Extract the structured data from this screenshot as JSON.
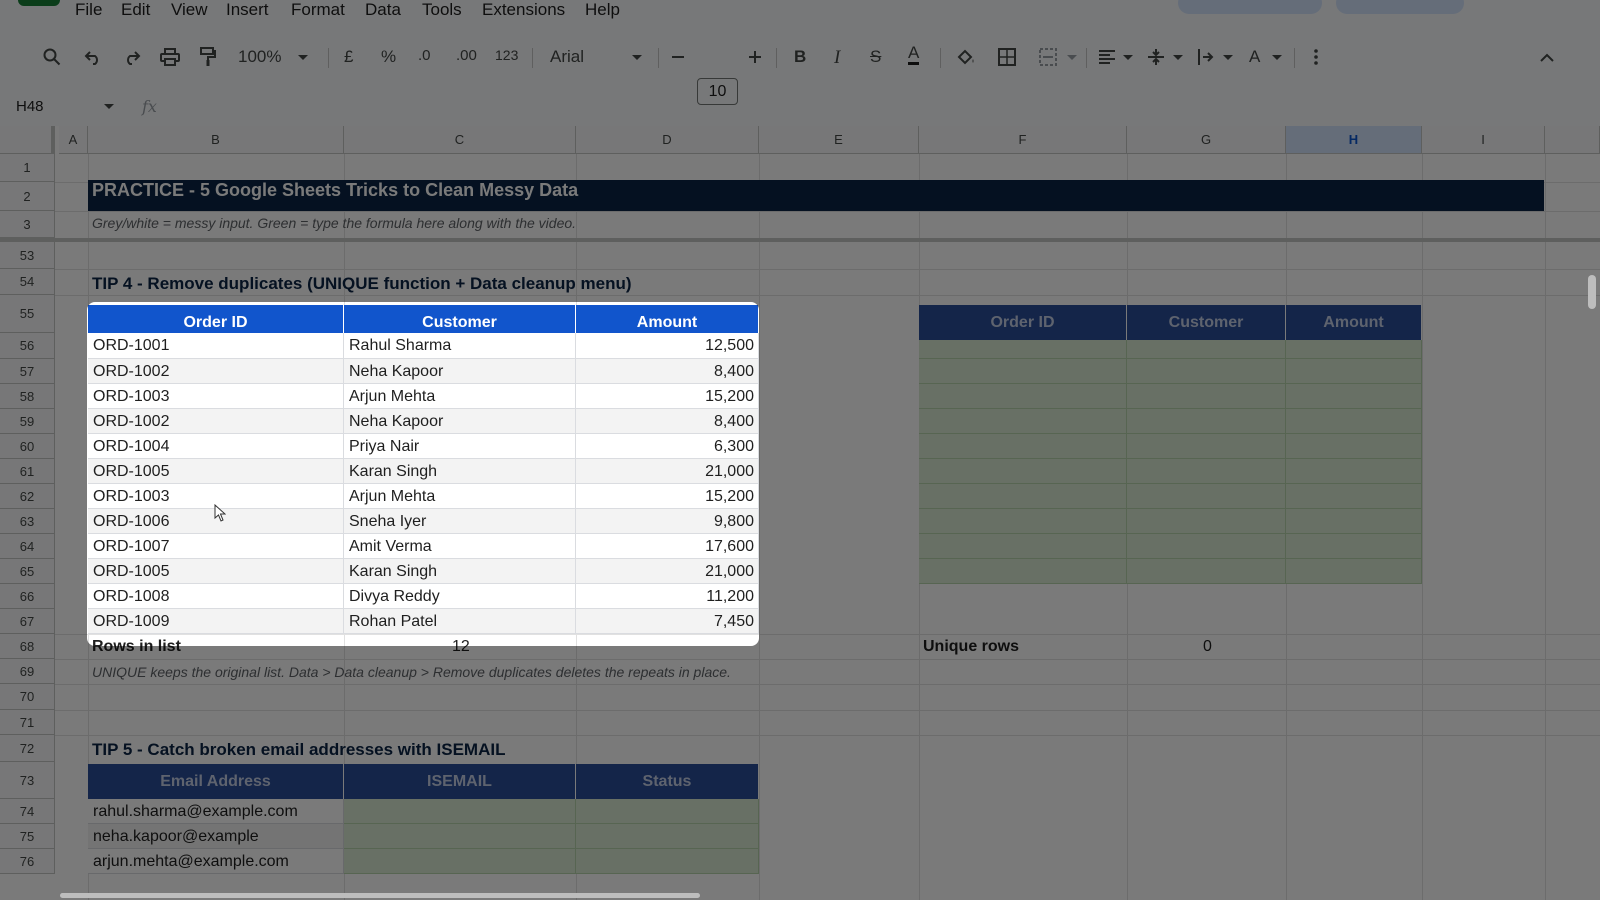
{
  "menu": [
    "File",
    "Edit",
    "View",
    "Insert",
    "Format",
    "Data",
    "Tools",
    "Extensions",
    "Help"
  ],
  "toolbar": {
    "zoom": "100%",
    "currency": "£",
    "percent": "%",
    "decrease_decimal": ".0",
    "increase_decimal": ".00",
    "number_format": "123",
    "font": "Arial",
    "font_size": "10",
    "bold": "B",
    "italic": "I",
    "strike": "S",
    "text_color": "A",
    "text_rotation": "A"
  },
  "formula_bar": {
    "cell_ref": "H48",
    "fx": "fx"
  },
  "columns": [
    "A",
    "B",
    "C",
    "D",
    "E",
    "F",
    "G",
    "H",
    "I"
  ],
  "selected_column": "H",
  "rows": [
    "1",
    "2",
    "3",
    "53",
    "54",
    "55",
    "56",
    "57",
    "58",
    "59",
    "60",
    "61",
    "62",
    "63",
    "64",
    "65",
    "66",
    "67",
    "68",
    "69",
    "70",
    "71",
    "72",
    "73",
    "74",
    "75",
    "76"
  ],
  "sheet": {
    "title": "PRACTICE  -  5 Google Sheets Tricks to Clean Messy Data",
    "subtitle": "Grey/white = messy input.  Green = type the formula here along with the video.",
    "tip4": {
      "heading": "TIP 4  -  Remove duplicates (UNIQUE function + Data cleanup menu)",
      "headers": [
        "Order ID",
        "Customer",
        "Amount"
      ],
      "rows": [
        [
          "ORD-1001",
          "Rahul Sharma",
          "12,500"
        ],
        [
          "ORD-1002",
          "Neha Kapoor",
          "8,400"
        ],
        [
          "ORD-1003",
          "Arjun Mehta",
          "15,200"
        ],
        [
          "ORD-1002",
          "Neha Kapoor",
          "8,400"
        ],
        [
          "ORD-1004",
          "Priya Nair",
          "6,300"
        ],
        [
          "ORD-1005",
          "Karan Singh",
          "21,000"
        ],
        [
          "ORD-1003",
          "Arjun Mehta",
          "15,200"
        ],
        [
          "ORD-1006",
          "Sneha Iyer",
          "9,800"
        ],
        [
          "ORD-1007",
          "Amit Verma",
          "17,600"
        ],
        [
          "ORD-1005",
          "Karan Singh",
          "21,000"
        ],
        [
          "ORD-1008",
          "Divya Reddy",
          "11,200"
        ],
        [
          "ORD-1009",
          "Rohan Patel",
          "7,450"
        ]
      ],
      "output_headers": [
        "Order ID",
        "Customer",
        "Amount"
      ],
      "rows_in_list_label": "Rows in list",
      "rows_in_list_value": "12",
      "unique_rows_label": "Unique rows",
      "unique_rows_value": "0",
      "note": "UNIQUE keeps the original list.  Data > Data cleanup > Remove duplicates deletes the repeats in place."
    },
    "tip5": {
      "heading": "TIP 5  -  Catch broken email addresses with ISEMAIL",
      "headers": [
        "Email Address",
        "ISEMAIL",
        "Status"
      ],
      "emails": [
        "rahul.sharma@example.com",
        "neha.kapoor@example",
        "arjun.mehta@example.com"
      ]
    }
  },
  "colors": {
    "header_blue": "#1155cc",
    "title_navy": "#0b2545",
    "input_green": "#d9ead3"
  }
}
